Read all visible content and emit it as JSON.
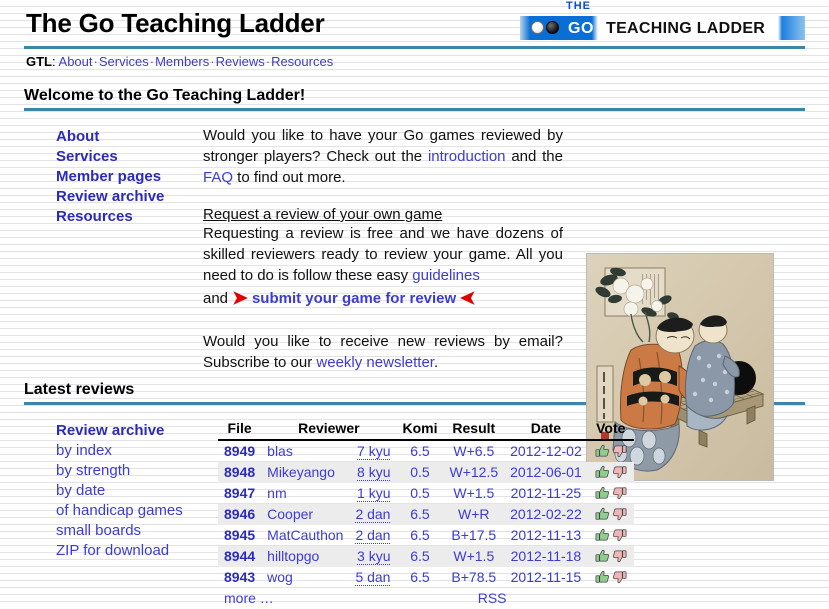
{
  "header": {
    "site_title": "The Go Teaching Ladder",
    "logo": {
      "the": "THE",
      "go": "GO",
      "teaching_ladder": "TEACHING LADDER",
      "accent_blue": "#0a6fd4",
      "the_color": "#0a50c8"
    }
  },
  "nav": {
    "brand": "GTL",
    "colon": ":",
    "items": [
      {
        "label": "About"
      },
      {
        "label": "Services"
      },
      {
        "label": "Members"
      },
      {
        "label": "Reviews"
      },
      {
        "label": "Resources"
      }
    ],
    "separator": "·"
  },
  "welcome": {
    "heading": "Welcome to the Go Teaching Ladder!",
    "side_links": [
      {
        "label": "About"
      },
      {
        "label": "Services"
      },
      {
        "label": "Member pages"
      },
      {
        "label": "Review archive"
      },
      {
        "label": "Resources"
      }
    ],
    "intro": {
      "part1": "Would you like to have your Go games reviewed by stronger players? Check out the ",
      "link1": "introduction",
      "part2": " and the ",
      "link2": "FAQ",
      "part3": " to find out more."
    },
    "request": {
      "subheading": "Request a review of your own game",
      "part1": "Requesting a review is free and we have dozens of skilled reviewers ready to review your game. All you need to do is follow these easy ",
      "link_guidelines": "guidelines",
      "part2": "and",
      "arrow_right": "➤",
      "submit_link": "submit your game for review",
      "arrow_left": "➤"
    },
    "newsletter": {
      "part1": "Would you like to receive new reviews by email? Subscribe to our ",
      "link": "weekly newsletter",
      "part2": "."
    },
    "artwork_alt": "Ukiyo-e woodblock print of two figures at a Go board"
  },
  "latest_reviews": {
    "heading": "Latest reviews",
    "side": {
      "heading": "Review archive",
      "links": [
        {
          "label": "by index"
        },
        {
          "label": "by strength"
        },
        {
          "label": "by date"
        },
        {
          "label": "of handicap games"
        },
        {
          "label": "small boards"
        },
        {
          "label": "ZIP for download"
        }
      ]
    },
    "table": {
      "columns": [
        "File",
        "Reviewer",
        "Komi",
        "Result",
        "Date",
        "Vote"
      ],
      "rows": [
        {
          "file": "8949",
          "reviewer": "blas",
          "rank": "7 kyu",
          "komi": "6.5",
          "result": "W+6.5",
          "date": "2012-12-02"
        },
        {
          "file": "8948",
          "reviewer": "Mikeyango",
          "rank": "8 kyu",
          "komi": "0.5",
          "result": "W+12.5",
          "date": "2012-06-01"
        },
        {
          "file": "8947",
          "reviewer": "nm",
          "rank": "1 kyu",
          "komi": "0.5",
          "result": "W+1.5",
          "date": "2012-11-25"
        },
        {
          "file": "8946",
          "reviewer": "Cooper",
          "rank": "2 dan",
          "komi": "6.5",
          "result": "W+R",
          "date": "2012-02-22"
        },
        {
          "file": "8945",
          "reviewer": "MatCauthon",
          "rank": "2 dan",
          "komi": "6.5",
          "result": "B+17.5",
          "date": "2012-11-13"
        },
        {
          "file": "8944",
          "reviewer": "hilltopgo",
          "rank": "3 kyu",
          "komi": "6.5",
          "result": "W+1.5",
          "date": "2012-11-18"
        },
        {
          "file": "8943",
          "reviewer": "wog",
          "rank": "5 dan",
          "komi": "6.5",
          "result": "B+78.5",
          "date": "2012-11-15"
        }
      ],
      "footer": {
        "more": "more …",
        "rss": "RSS"
      },
      "vote_up_color": "#8fce8f",
      "vote_down_color": "#eeb6b6"
    }
  }
}
